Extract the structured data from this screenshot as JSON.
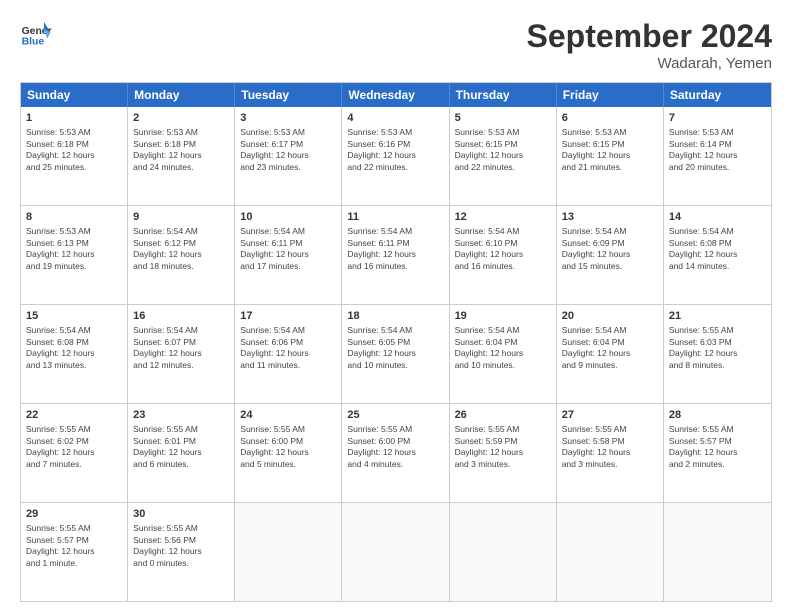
{
  "header": {
    "logo_line1": "General",
    "logo_line2": "Blue",
    "month_title": "September 2024",
    "location": "Wadarah, Yemen"
  },
  "weekdays": [
    "Sunday",
    "Monday",
    "Tuesday",
    "Wednesday",
    "Thursday",
    "Friday",
    "Saturday"
  ],
  "rows": [
    [
      {
        "day": "",
        "info": ""
      },
      {
        "day": "2",
        "info": "Sunrise: 5:53 AM\nSunset: 6:18 PM\nDaylight: 12 hours\nand 24 minutes."
      },
      {
        "day": "3",
        "info": "Sunrise: 5:53 AM\nSunset: 6:17 PM\nDaylight: 12 hours\nand 23 minutes."
      },
      {
        "day": "4",
        "info": "Sunrise: 5:53 AM\nSunset: 6:16 PM\nDaylight: 12 hours\nand 22 minutes."
      },
      {
        "day": "5",
        "info": "Sunrise: 5:53 AM\nSunset: 6:15 PM\nDaylight: 12 hours\nand 22 minutes."
      },
      {
        "day": "6",
        "info": "Sunrise: 5:53 AM\nSunset: 6:15 PM\nDaylight: 12 hours\nand 21 minutes."
      },
      {
        "day": "7",
        "info": "Sunrise: 5:53 AM\nSunset: 6:14 PM\nDaylight: 12 hours\nand 20 minutes."
      }
    ],
    [
      {
        "day": "8",
        "info": "Sunrise: 5:53 AM\nSunset: 6:13 PM\nDaylight: 12 hours\nand 19 minutes."
      },
      {
        "day": "9",
        "info": "Sunrise: 5:54 AM\nSunset: 6:12 PM\nDaylight: 12 hours\nand 18 minutes."
      },
      {
        "day": "10",
        "info": "Sunrise: 5:54 AM\nSunset: 6:11 PM\nDaylight: 12 hours\nand 17 minutes."
      },
      {
        "day": "11",
        "info": "Sunrise: 5:54 AM\nSunset: 6:11 PM\nDaylight: 12 hours\nand 16 minutes."
      },
      {
        "day": "12",
        "info": "Sunrise: 5:54 AM\nSunset: 6:10 PM\nDaylight: 12 hours\nand 16 minutes."
      },
      {
        "day": "13",
        "info": "Sunrise: 5:54 AM\nSunset: 6:09 PM\nDaylight: 12 hours\nand 15 minutes."
      },
      {
        "day": "14",
        "info": "Sunrise: 5:54 AM\nSunset: 6:08 PM\nDaylight: 12 hours\nand 14 minutes."
      }
    ],
    [
      {
        "day": "15",
        "info": "Sunrise: 5:54 AM\nSunset: 6:08 PM\nDaylight: 12 hours\nand 13 minutes."
      },
      {
        "day": "16",
        "info": "Sunrise: 5:54 AM\nSunset: 6:07 PM\nDaylight: 12 hours\nand 12 minutes."
      },
      {
        "day": "17",
        "info": "Sunrise: 5:54 AM\nSunset: 6:06 PM\nDaylight: 12 hours\nand 11 minutes."
      },
      {
        "day": "18",
        "info": "Sunrise: 5:54 AM\nSunset: 6:05 PM\nDaylight: 12 hours\nand 10 minutes."
      },
      {
        "day": "19",
        "info": "Sunrise: 5:54 AM\nSunset: 6:04 PM\nDaylight: 12 hours\nand 10 minutes."
      },
      {
        "day": "20",
        "info": "Sunrise: 5:54 AM\nSunset: 6:04 PM\nDaylight: 12 hours\nand 9 minutes."
      },
      {
        "day": "21",
        "info": "Sunrise: 5:55 AM\nSunset: 6:03 PM\nDaylight: 12 hours\nand 8 minutes."
      }
    ],
    [
      {
        "day": "22",
        "info": "Sunrise: 5:55 AM\nSunset: 6:02 PM\nDaylight: 12 hours\nand 7 minutes."
      },
      {
        "day": "23",
        "info": "Sunrise: 5:55 AM\nSunset: 6:01 PM\nDaylight: 12 hours\nand 6 minutes."
      },
      {
        "day": "24",
        "info": "Sunrise: 5:55 AM\nSunset: 6:00 PM\nDaylight: 12 hours\nand 5 minutes."
      },
      {
        "day": "25",
        "info": "Sunrise: 5:55 AM\nSunset: 6:00 PM\nDaylight: 12 hours\nand 4 minutes."
      },
      {
        "day": "26",
        "info": "Sunrise: 5:55 AM\nSunset: 5:59 PM\nDaylight: 12 hours\nand 3 minutes."
      },
      {
        "day": "27",
        "info": "Sunrise: 5:55 AM\nSunset: 5:58 PM\nDaylight: 12 hours\nand 3 minutes."
      },
      {
        "day": "28",
        "info": "Sunrise: 5:55 AM\nSunset: 5:57 PM\nDaylight: 12 hours\nand 2 minutes."
      }
    ],
    [
      {
        "day": "29",
        "info": "Sunrise: 5:55 AM\nSunset: 5:57 PM\nDaylight: 12 hours\nand 1 minute."
      },
      {
        "day": "30",
        "info": "Sunrise: 5:55 AM\nSunset: 5:56 PM\nDaylight: 12 hours\nand 0 minutes."
      },
      {
        "day": "",
        "info": ""
      },
      {
        "day": "",
        "info": ""
      },
      {
        "day": "",
        "info": ""
      },
      {
        "day": "",
        "info": ""
      },
      {
        "day": "",
        "info": ""
      }
    ]
  ],
  "row0_day1": {
    "day": "1",
    "info": "Sunrise: 5:53 AM\nSunset: 6:18 PM\nDaylight: 12 hours\nand 25 minutes."
  }
}
